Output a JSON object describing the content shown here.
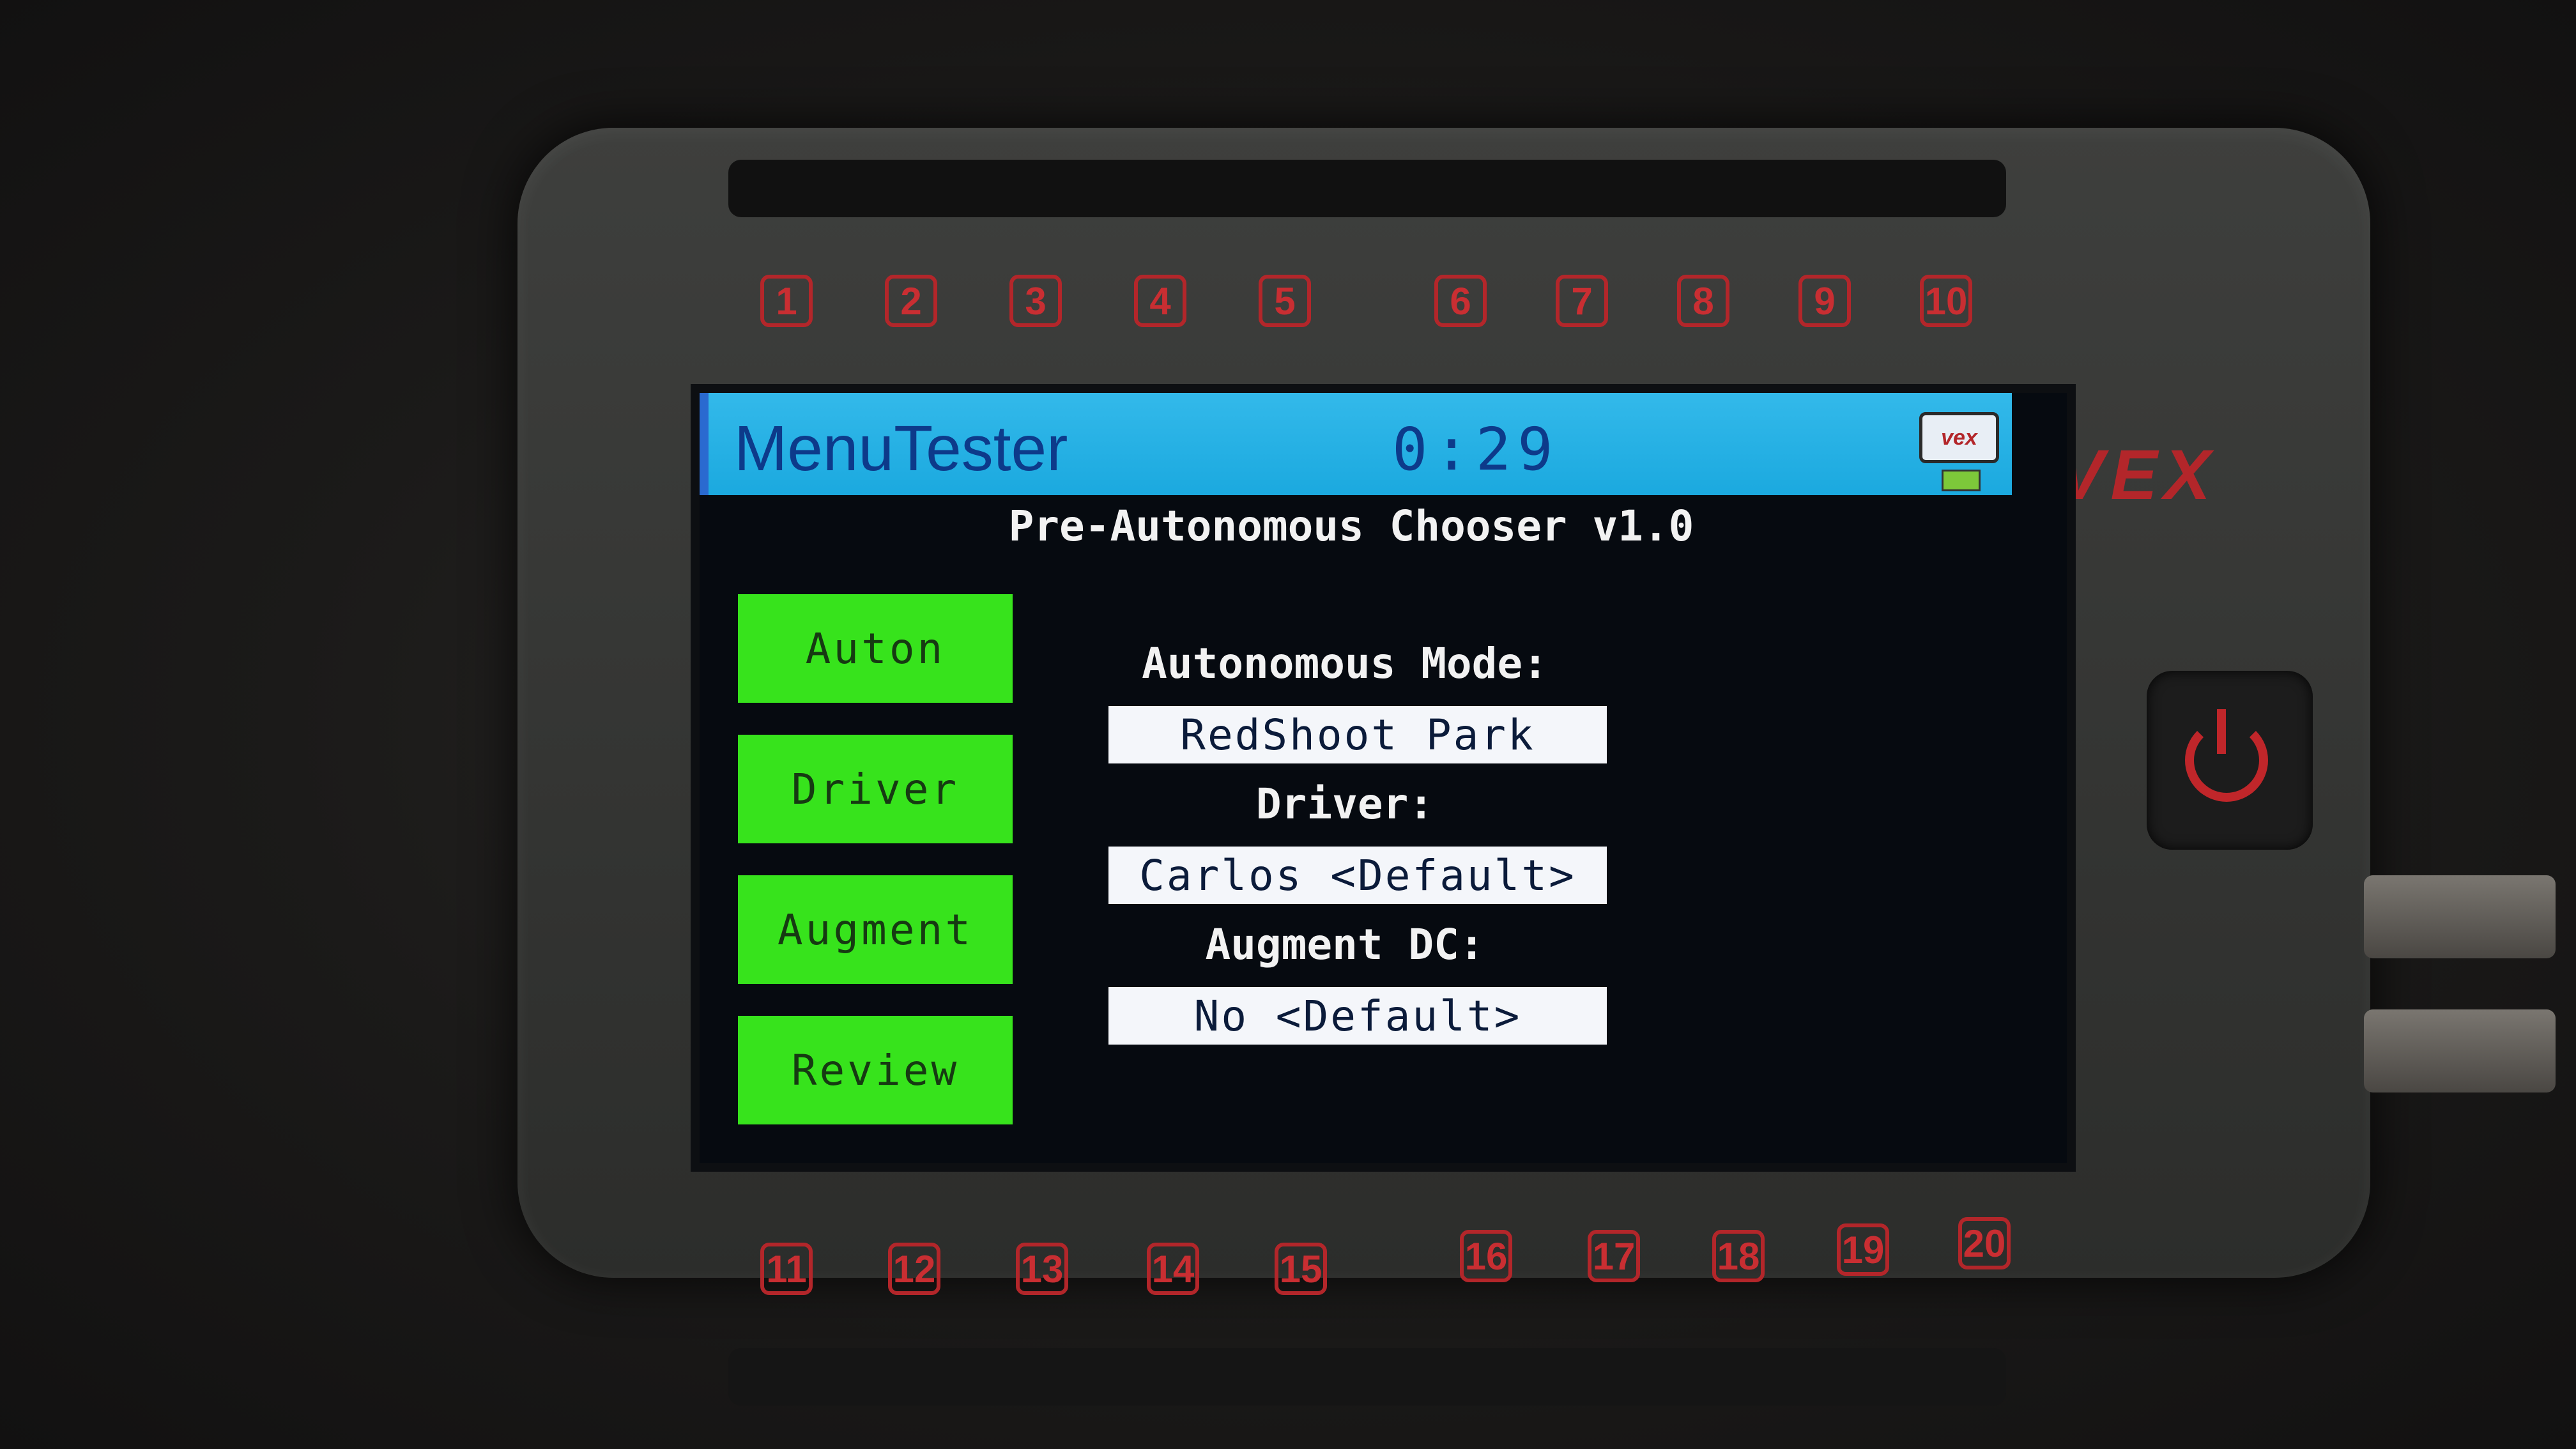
{
  "device": {
    "logo": "VEX",
    "top_ports": [
      "1",
      "2",
      "3",
      "4",
      "5",
      "6",
      "7",
      "8",
      "9",
      "10"
    ],
    "bottom_ports": [
      "11",
      "12",
      "13",
      "14",
      "15",
      "16",
      "17",
      "18",
      "19",
      "20"
    ]
  },
  "titlebar": {
    "app_name": "MenuTester",
    "clock": "0:29",
    "badge_icon": "vex-badge-icon",
    "battery_icon": "battery-icon"
  },
  "screen": {
    "title": "Pre-Autonomous Chooser v1.0",
    "buttons": [
      {
        "label": "Auton"
      },
      {
        "label": "Driver"
      },
      {
        "label": "Augment"
      },
      {
        "label": "Review"
      }
    ],
    "fields": [
      {
        "label": "Autonomous Mode:",
        "value": "RedShoot Park"
      },
      {
        "label": "Driver:",
        "value": "Carlos <Default>"
      },
      {
        "label": "Augment DC:",
        "value": "No <Default>"
      }
    ]
  },
  "colors": {
    "titlebar": "#1ba9df",
    "button_green": "#37e31c",
    "port_red": "#b3262a"
  }
}
